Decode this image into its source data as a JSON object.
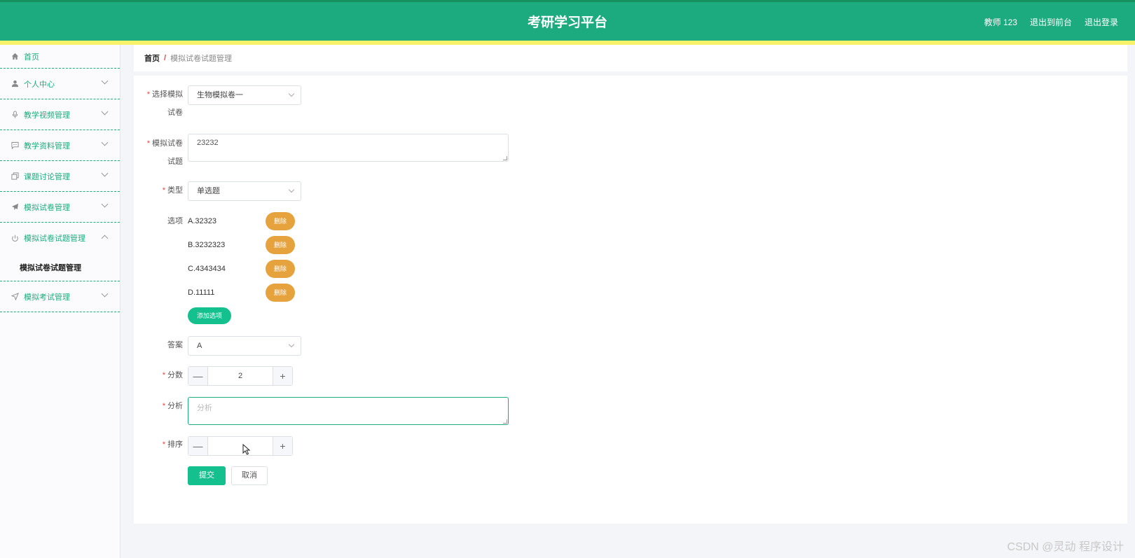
{
  "header": {
    "title": "考研学习平台",
    "user": "教师 123",
    "to_front": "退出到前台",
    "logout": "退出登录",
    "color": "#1cab7e",
    "strip_color": "#f7f26a"
  },
  "sidebar": {
    "items": [
      {
        "label": "首页",
        "icon": "home-icon"
      },
      {
        "label": "个人中心",
        "icon": "user-icon"
      },
      {
        "label": "教学视频管理",
        "icon": "microphone-icon"
      },
      {
        "label": "教学资料管理",
        "icon": "chat-icon"
      },
      {
        "label": "课题讨论管理",
        "icon": "copy-icon"
      },
      {
        "label": "模拟试卷管理",
        "icon": "send-icon"
      },
      {
        "label": "模拟试卷试题管理",
        "icon": "power-icon"
      },
      {
        "label": "模拟考试管理",
        "icon": "navigation-icon"
      }
    ],
    "submenu_label": "模拟试卷试题管理"
  },
  "breadcrumb": {
    "home": "首页",
    "separator": "/",
    "current": "模拟试卷试题管理"
  },
  "form": {
    "paper": {
      "label_line1": "选择模拟",
      "label_line2": "试卷",
      "value": "生物模拟卷一"
    },
    "question": {
      "label_line1": "模拟试卷",
      "label_line2": "试题",
      "value": "23232"
    },
    "type": {
      "label": "类型",
      "value": "单选题"
    },
    "options_label": "选项",
    "options": [
      "A.32323",
      "B.3232323",
      "C.4343434",
      "D.11111"
    ],
    "delete_label": "删除",
    "add_option_label": "添加选项",
    "answer": {
      "label": "答案",
      "value": "A"
    },
    "score": {
      "label": "分数",
      "value": "2",
      "minus": "—",
      "plus": "+"
    },
    "analysis": {
      "label": "分析",
      "placeholder": "分析"
    },
    "order": {
      "label": "排序",
      "value": "",
      "minus": "—",
      "plus": "+"
    },
    "submit_label": "提交",
    "cancel_label": "取消",
    "required_mark": "*"
  },
  "watermark": "CSDN @灵动 程序设计",
  "colors": {
    "accent": "#1cab7e",
    "danger_btn": "#e6a23c",
    "primary_btn": "#13c08e",
    "required": "#e9443c"
  }
}
